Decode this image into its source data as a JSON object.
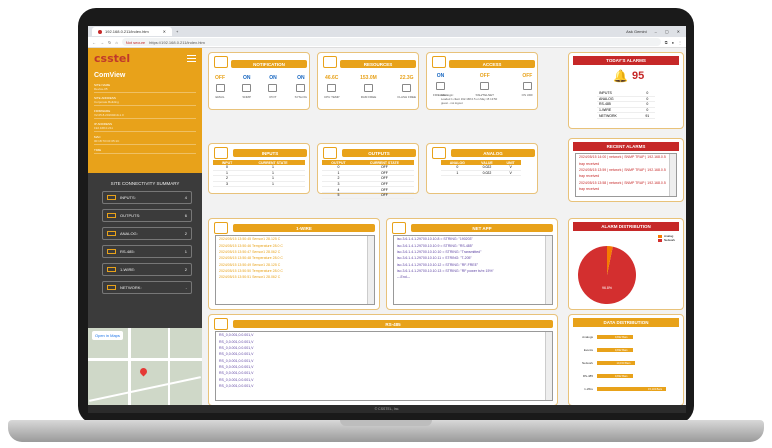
{
  "browser": {
    "tab_title": "192.168.0.211/index.htm",
    "address_secure": "Not secure",
    "address_url": "https://192.168.0.211/index.htm",
    "ask_label": "Ask Gemini"
  },
  "sidebar": {
    "logo": "csstel",
    "app_title": "ComView",
    "fields": [
      {
        "label": "SITE NAME",
        "value": "Device-05"
      },
      {
        "label": "SITE ADDRESS",
        "value": "Corporate Building"
      },
      {
        "label": "FIRMWARE",
        "value": "V2.05.8.20190219-1.0"
      },
      {
        "label": "IP ADDRESS",
        "value": "192.168.0.211"
      },
      {
        "label": "MAC",
        "value": "00:18:73:CF:05:1C"
      },
      {
        "label": "TIME",
        "value": ""
      }
    ],
    "summary_title": "SITE CONNECTIVITY SUMMARY",
    "summary": [
      {
        "label": "INPUTS:",
        "value": "4"
      },
      {
        "label": "OUTPUTS:",
        "value": "6"
      },
      {
        "label": "ANALOG:",
        "value": "2"
      },
      {
        "label": "RS-485:",
        "value": "1"
      },
      {
        "label": "1-WIRE:",
        "value": "2"
      },
      {
        "label": "NETWORK:",
        "value": "-"
      }
    ],
    "map_button": "Open in Maps"
  },
  "notification": {
    "title": "NOTIFICATION",
    "items": [
      {
        "state": "OFF",
        "label": "EMAIL"
      },
      {
        "state": "ON",
        "label": "SNMP"
      },
      {
        "state": "ON",
        "label": "IPOT"
      },
      {
        "state": "ON",
        "label": "SYSLOG"
      }
    ]
  },
  "resources": {
    "title": "RESOURCES",
    "items": [
      {
        "value": "46.6C",
        "label": "CPU TEMP"
      },
      {
        "value": "153.0M",
        "label": "RAM FREE"
      },
      {
        "value": "22.3G",
        "label": "FLASH FREE"
      }
    ]
  },
  "access": {
    "title": "ACCESS",
    "items": [
      {
        "state": "ON",
        "label": "FIREWALL"
      },
      {
        "state": "OFF",
        "label": "SSH/TELNET"
      },
      {
        "state": "OFF",
        "label": "OS UDF"
      }
    ],
    "last_login": "Last login:",
    "login_info": "Loaded 1 client 192.168.0.5 on May 15 13:50",
    "login_user": "guest - not logout"
  },
  "alarms": {
    "title": "TODAY'S ALARMS",
    "count": "95",
    "rows": [
      {
        "label": "INPUTS",
        "value": "0"
      },
      {
        "label": "ANALOG",
        "value": "0"
      },
      {
        "label": "RS-485",
        "value": "0"
      },
      {
        "label": "1-WIRE",
        "value": "0"
      },
      {
        "label": "NETWORK",
        "value": "91"
      }
    ]
  },
  "inputs": {
    "title": "INPUTS",
    "columns": [
      "INPUT",
      "CURRENT STATE"
    ],
    "rows": [
      [
        "0",
        "1"
      ],
      [
        "1",
        "1"
      ],
      [
        "2",
        "1"
      ],
      [
        "3",
        "1"
      ]
    ]
  },
  "outputs": {
    "title": "OUTPUTS",
    "columns": [
      "OUTPUT",
      "CURRENT STATE"
    ],
    "rows": [
      [
        "0",
        "OFF"
      ],
      [
        "1",
        "OFF"
      ],
      [
        "2",
        "OFF"
      ],
      [
        "3",
        "OFF"
      ],
      [
        "4",
        "OFF"
      ],
      [
        "5",
        "OFF"
      ]
    ]
  },
  "analog": {
    "title": "ANALOG",
    "columns": [
      "ANALOG",
      "VALUE",
      "UNIT"
    ],
    "rows": [
      [
        "0",
        "0.022",
        "V"
      ],
      [
        "1",
        "0.022",
        "V"
      ]
    ]
  },
  "recent_alarms": {
    "title": "RECENT ALARMS",
    "entries": [
      "2024/05/15 14:00 | network | SNMP TRAP | 192.168.0.5",
      "trap received",
      "2024/05/15 13:59 | network | SNMP TRAP | 192.168.0.5",
      "trap received",
      "2024/05/15 13:58 | network | SNMP TRAP | 192.168.0.5",
      "trap received"
    ]
  },
  "onewire": {
    "title": "1-WIRE",
    "lines": [
      "2024/05/15 13:50:45 Sensor1 28.125 C",
      "2024/05/15 13:50:46 Temperature 28.0 C",
      "2024/05/15 13:50:47 Sensor1 28.062 C",
      "2024/05/15 13:50:48 Temperature 28.0 C",
      "2024/05/15 13:50:49 Sensor1 28.125 C",
      "2024/05/15 13:50:50 Temperature 28.0 C",
      "2024/05/15 13:50:51 Sensor1 28.062 C"
    ]
  },
  "netapp": {
    "title": "NET APP",
    "lines": [
      "iso.3.6.1.4.1.29700.10.10.8 = STRING: \"190203\"",
      "iso.3.6.1.4.1.29700.10.10.9 = STRING: \"RS-485\"",
      "iso.3.6.1.4.1.29700.10.10.10 = STRING: \"Transmitted\"",
      "iso.3.6.1.4.1.29700.10.10.11 = STRING: \"T-205\"",
      "iso.3.6.1.4.1.29700.10.10.12 = STRING: \"RF-FREE\"",
      "iso.3.6.1.4.1.29700.10.10.13 = STRING: \"RF power tx/rx 15%\"",
      "---End---"
    ]
  },
  "rs485": {
    "title": "RS-485",
    "lines": [
      "RS_0,0.001,0.0.001,V",
      "RS_0,0.001,0.0.001,V",
      "RS_0,0.001,0.0.001,V",
      "RS_0,0.001,0.0.001,V",
      "RS_0,0.001,0.0.001,V",
      "RS_0,0.001,0.0.001,V",
      "RS_0,0.001,0.0.001,V",
      "RS_0,0.001,0.0.001,V",
      "RS_0,0.001,0.0.001,V"
    ]
  },
  "alarm_distribution": {
    "title": "ALARM DISTRIBUTION",
    "legend": [
      "Analog",
      "Network"
    ],
    "colors": {
      "analog": "#f57c00",
      "network": "#d32f2f"
    },
    "slice_label": "96.8%",
    "network_share": 96.8
  },
  "data_distribution": {
    "title": "DATA DISTRIBUTION",
    "bars": [
      {
        "label": "Analogs",
        "value": "9,832 Bars",
        "fraction": 0.24
      },
      {
        "label": "Events",
        "value": "9,832 Bars",
        "fraction": 0.24
      },
      {
        "label": "Network",
        "value": "10,150 Bars",
        "fraction": 0.25
      },
      {
        "label": "RS-485",
        "value": "9,832 Bars",
        "fraction": 0.24
      },
      {
        "label": "1-Wire",
        "value": "15,134 Bars",
        "fraction": 0.46
      }
    ]
  },
  "footer": "© CSSTEL, Inc."
}
